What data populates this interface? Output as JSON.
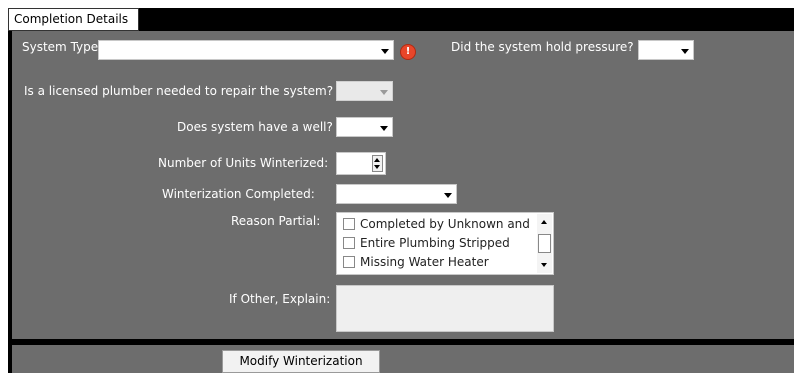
{
  "tab": {
    "label": "Completion Details"
  },
  "form": {
    "system_type": {
      "label": "System Type:",
      "value": ""
    },
    "hold_pressure": {
      "label": "Did the system hold pressure?",
      "value": ""
    },
    "licensed_plumber": {
      "label": "Is a licensed plumber needed to repair the system?",
      "value": ""
    },
    "has_well": {
      "label": "Does system have a well?",
      "value": ""
    },
    "units_winterized": {
      "label": "Number of Units Winterized:",
      "value": ""
    },
    "winterization_completed": {
      "label": "Winterization Completed:",
      "value": ""
    },
    "reason_partial": {
      "label": "Reason Partial:",
      "options": [
        {
          "label": "Completed by Unknown and",
          "checked": false
        },
        {
          "label": "Entire Plumbing Stripped",
          "checked": false
        },
        {
          "label": "Missing Water Heater",
          "checked": false
        }
      ]
    },
    "other_explain": {
      "label": "If Other, Explain:",
      "value": ""
    }
  },
  "alert_glyph": "!",
  "actions": {
    "modify_label": "Modify Winterization"
  },
  "colors": {
    "panel": "#6d6d6d",
    "frame": "#000000",
    "alert": "#e8462a"
  }
}
